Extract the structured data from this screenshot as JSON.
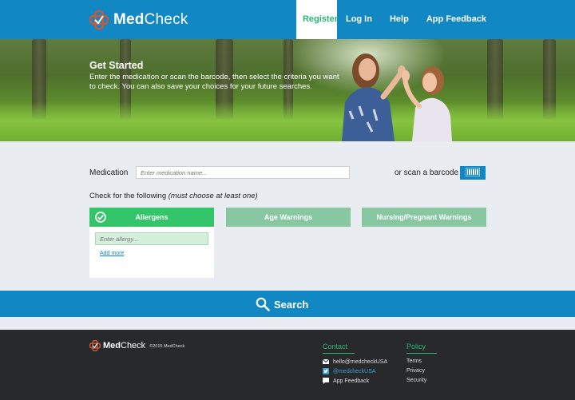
{
  "header": {
    "brand_bold": "Med",
    "brand_rest": "Check",
    "nav": [
      "Register",
      "Log In",
      "Help",
      "App Feedback"
    ],
    "accent": "#1188c4",
    "active_color": "#2bb673"
  },
  "hero": {
    "title": "Get Started",
    "description": "Enter the medication or scan the barcode, then select the criteria you want to check. You can also save your choices for your future searches."
  },
  "form": {
    "medication_label": "Medication",
    "medication_placeholder": "Enter medication name...",
    "scan_label": "or scan a barcode",
    "scan_icon": "barcode-icon",
    "check_label": "Check for the following",
    "check_note": "(must choose at least one)",
    "tabs": [
      "Allergens",
      "Age Warnings",
      "Nursing/Pregnant Warnings"
    ],
    "allergy_placeholder": "Enter allergy...",
    "add_more": "Add more",
    "search_label": "Search"
  },
  "footer": {
    "brand_bold": "Med",
    "brand_rest": "Check",
    "copyright": "©2015 MedCheck",
    "contact_title": "Contact",
    "contact": {
      "email": "hello@medcheckUSA",
      "twitter": "@medcheckUSA",
      "feedback": "App Feedback"
    },
    "policy_title": "Policy",
    "policy": [
      "Terms",
      "Privacy",
      "Security"
    ]
  }
}
